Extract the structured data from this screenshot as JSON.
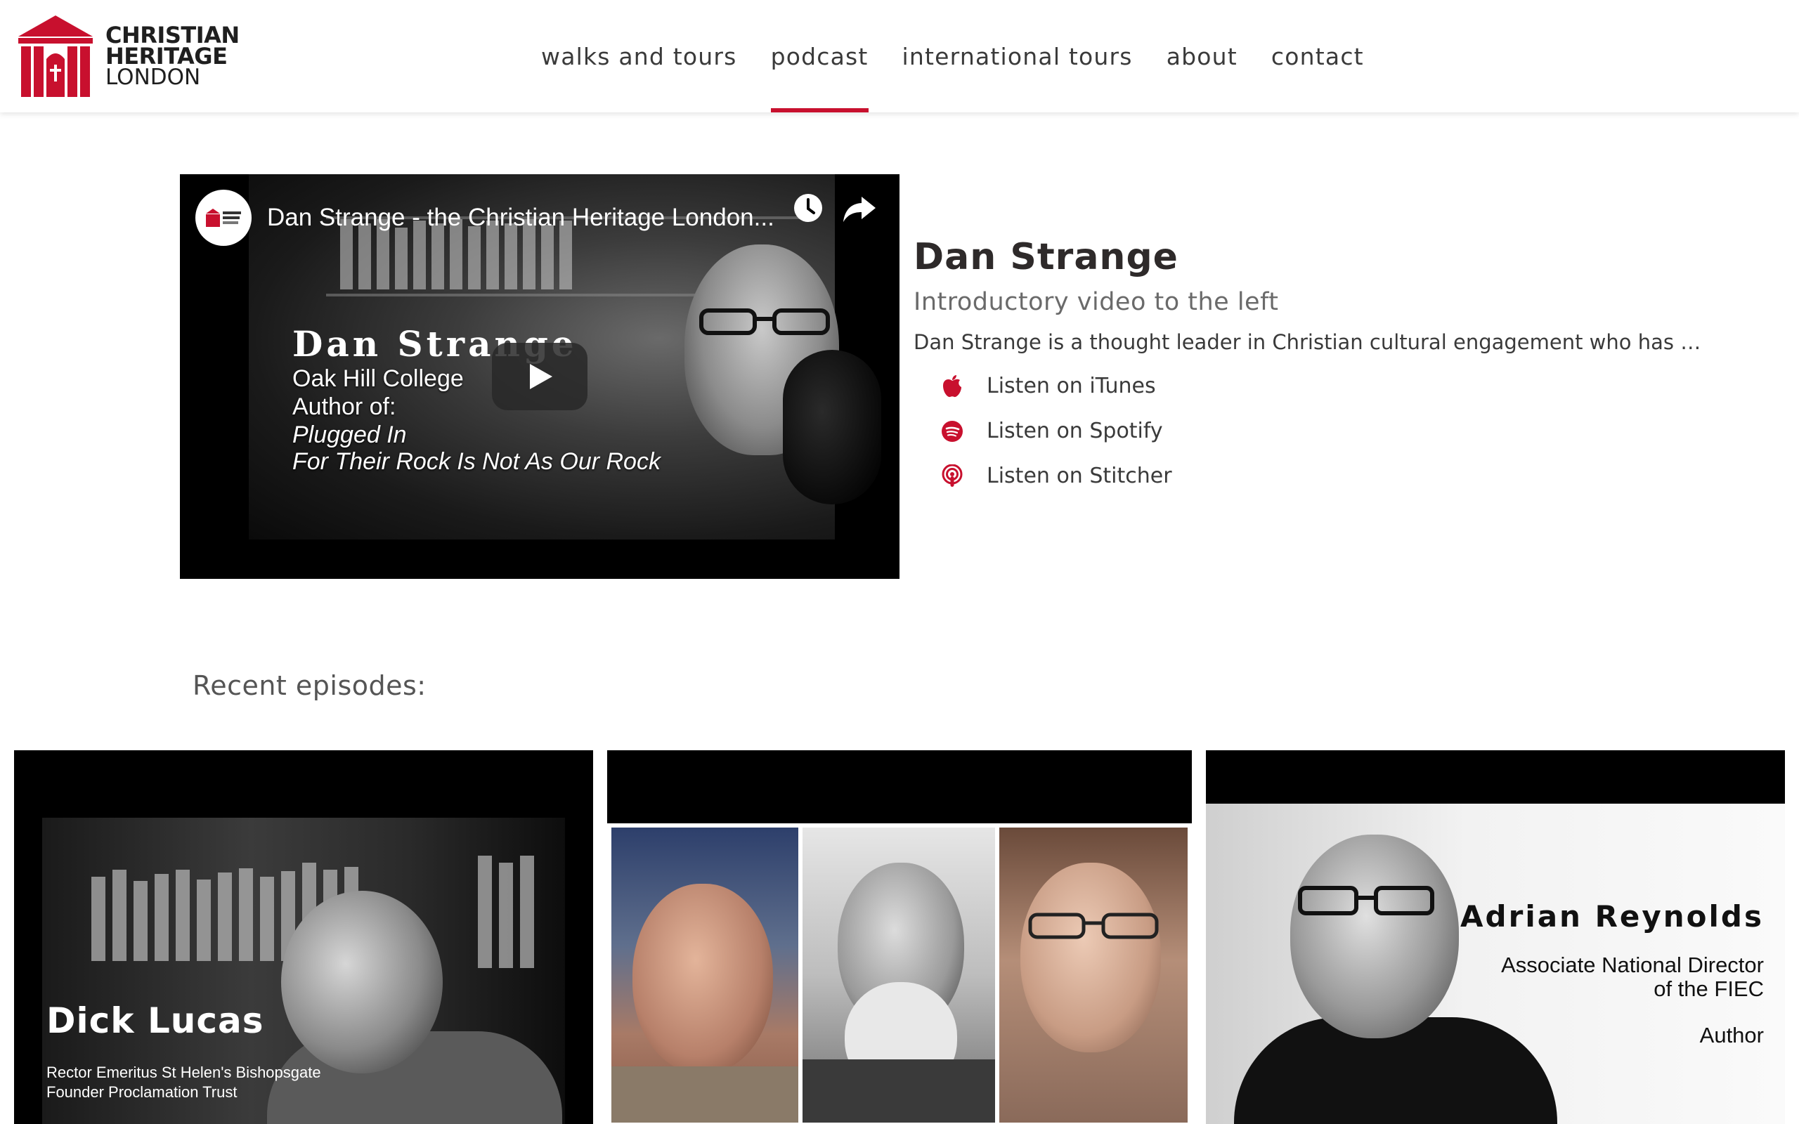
{
  "brand": {
    "logo_line1": "CHRISTIAN",
    "logo_line2": "HERITAGE",
    "logo_line3": "LONDON",
    "accent_color": "#c8102e"
  },
  "nav": {
    "items": [
      {
        "label": "walks and tours",
        "active": false
      },
      {
        "label": "podcast",
        "active": true
      },
      {
        "label": "international tours",
        "active": false
      },
      {
        "label": "about",
        "active": false
      },
      {
        "label": "contact",
        "active": false
      }
    ]
  },
  "video": {
    "title": "Dan Strange - the Christian Heritage London...",
    "channel_avatar_icon": "christian-heritage-logo",
    "overlay_name": "Dan Strange",
    "overlay_lines": [
      "Oak Hill College",
      "Author of:",
      "Plugged In",
      "For Their Rock Is Not As Our Rock"
    ],
    "watch_later_icon": "clock-icon",
    "share_icon": "share-icon",
    "play_icon": "play-icon"
  },
  "episode": {
    "title": "Dan Strange",
    "subtitle": "Introductory video to the left",
    "description": "Dan Strange is a thought leader in Christian cultural engagement who has …",
    "listen_links": [
      {
        "label": "Listen on iTunes",
        "icon": "apple-icon"
      },
      {
        "label": "Listen on Spotify",
        "icon": "spotify-icon"
      },
      {
        "label": "Listen on Stitcher",
        "icon": "podcast-icon"
      }
    ]
  },
  "recent": {
    "heading": "Recent episodes:",
    "cards": [
      {
        "name": "Dick Lucas",
        "lines": [
          "Rector Emeritus St Helen's Bishopsgate",
          "Founder Proclamation Trust"
        ]
      },
      {
        "name": "",
        "lines": []
      },
      {
        "name": "Adrian Reynolds",
        "lines": [
          "Associate National Director",
          "of the FIEC",
          "Author"
        ]
      }
    ]
  }
}
